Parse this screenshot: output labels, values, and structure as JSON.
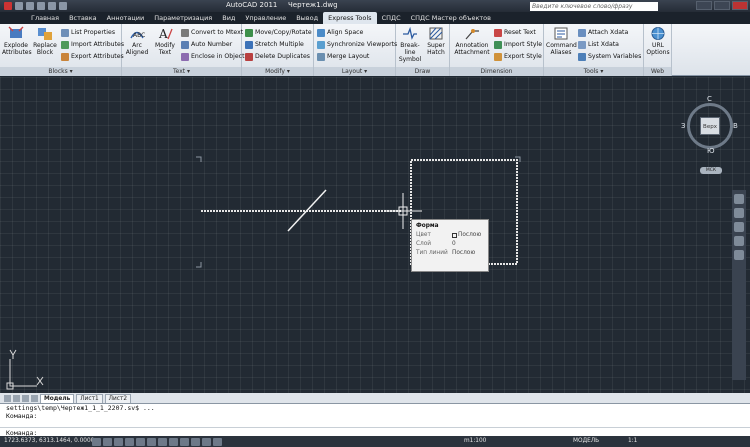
{
  "window": {
    "app_title": "AutoCAD 2011",
    "file_title": "Чертеж1.dwg",
    "search_placeholder": "Введите ключевое слово/фразу"
  },
  "tabs": [
    {
      "label": "Главная"
    },
    {
      "label": "Вставка"
    },
    {
      "label": "Аннотации"
    },
    {
      "label": "Параметризация"
    },
    {
      "label": "Вид"
    },
    {
      "label": "Управление"
    },
    {
      "label": "Вывод"
    },
    {
      "label": "Express Tools",
      "active": true
    },
    {
      "label": "СПДС"
    },
    {
      "label": "СПДС Мастер объектов"
    }
  ],
  "ribbon": {
    "blocks": {
      "title": "Blocks",
      "explode_attributes": "Explode Attributes",
      "replace_block": "Replace Block",
      "list_properties": "List Properties",
      "import_attributes": "Import Attributes",
      "export_attributes": "Export Attributes"
    },
    "text": {
      "title": "Text",
      "arc_aligned": "Arc Aligned",
      "modify_text": "Modify Text",
      "convert_to_mtext": "Convert to Mtext",
      "auto_number": "Auto Number",
      "enclose_in_object": "Enclose in Object"
    },
    "modify": {
      "title": "Modify",
      "move_copy_rotate": "Move/Copy/Rotate",
      "stretch_multiple": "Stretch Multiple",
      "delete_duplicates": "Delete Duplicates"
    },
    "layout": {
      "title": "Layout",
      "align_space": "Align Space",
      "synchronize_viewports": "Synchronize Viewports",
      "merge_layout": "Merge Layout"
    },
    "draw": {
      "title": "Draw",
      "break_line_symbol": "Break-line Symbol",
      "super_hatch": "Super Hatch"
    },
    "dimension": {
      "title": "Dimension",
      "annotation_attachment": "Annotation Attachment",
      "reset_text": "Reset Text",
      "import_style": "Import Style",
      "export_style": "Export Style"
    },
    "tools": {
      "title": "Tools",
      "command_aliases": "Command Aliases",
      "attach_xdata": "Attach Xdata",
      "list_xdata": "List Xdata",
      "system_variables": "System Variables"
    },
    "web": {
      "title": "Web",
      "url_options": "URL Options"
    }
  },
  "viewcube": {
    "face": "Верх",
    "north": "С",
    "south": "Ю",
    "west": "З",
    "east": "В",
    "wcs": "МСК"
  },
  "tooltip": {
    "title": "Форма",
    "rows": [
      {
        "key": "Цвет",
        "value": "Послою"
      },
      {
        "key": "Слой",
        "value": "0"
      },
      {
        "key": "Тип линий",
        "value": "Послою"
      }
    ]
  },
  "ucs": {
    "x": "X",
    "y": "Y"
  },
  "layout_tabs": [
    "Модель",
    "Лист1",
    "Лист2"
  ],
  "command_line": {
    "line1": "settings\\temp\\Чертеж1_1_1_2207.sv$ ...",
    "line2": "Команда:",
    "prompt": "Команда:"
  },
  "status": {
    "coords": "1723.6373, 6313.1464, 0.0000",
    "scale": "m1:100",
    "model": "МОДЕЛЬ",
    "annotation_scale": "1:1"
  },
  "colors": {
    "canvas_bg": "#222a33",
    "ribbon_bg": "#e6ebf0",
    "titlebar_bg": "#2e3641"
  }
}
